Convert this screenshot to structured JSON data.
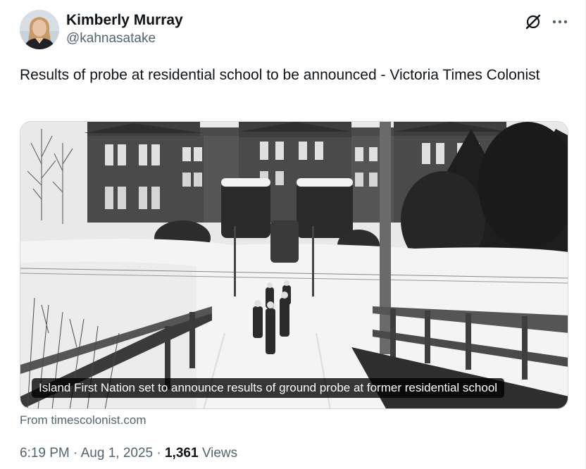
{
  "author": {
    "display_name": "Kimberly Murray",
    "handle": "@kahnasatake"
  },
  "tweet": {
    "text": "Results of probe at residential school to be announced - Victoria Times Colonist"
  },
  "card": {
    "caption": "Island First Nation set to announce results of ground probe at former residential school",
    "source": "From timescolonist.com"
  },
  "meta": {
    "time": "6:19 PM",
    "separator": "·",
    "date": "Aug 1, 2025",
    "views_count": "1,361",
    "views_label": "Views"
  },
  "icons": {
    "grok": "grok-icon",
    "more": "more-icon"
  },
  "colors": {
    "text": "#0f1419",
    "secondary": "#536471",
    "border": "#cfd9de"
  }
}
